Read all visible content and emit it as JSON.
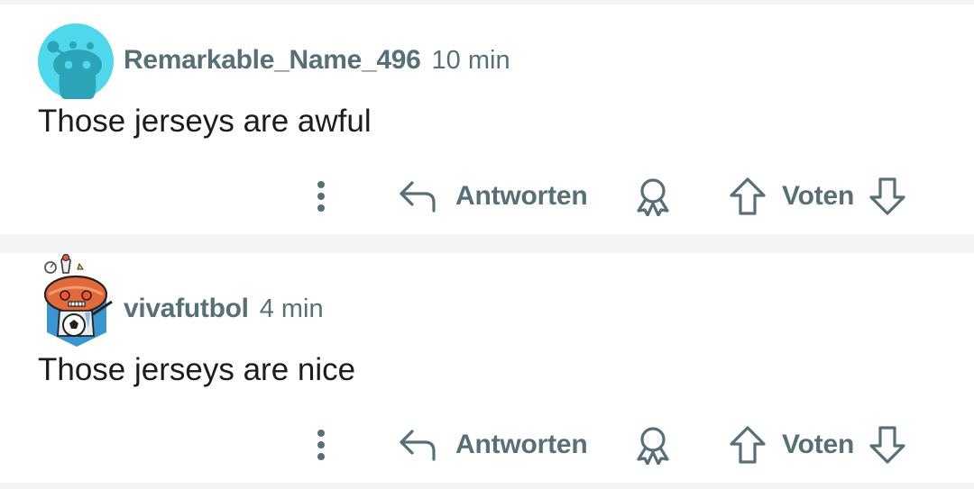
{
  "comments": [
    {
      "username": "Remarkable_Name_496",
      "time": "10 min",
      "text": "Those jerseys are awful",
      "avatar_icon": "snoo-avatar-icon",
      "avatar_bg": "#4FD8EB"
    },
    {
      "username": "vivafutbol",
      "time": "4 min",
      "text": "Those jerseys are nice",
      "avatar_icon": "snoo-football-avatar-icon",
      "avatar_bg": "#FFFFFF"
    }
  ],
  "actions": {
    "more_icon": "more-vertical-icon",
    "reply_icon": "reply-arrow-icon",
    "reply_label": "Antworten",
    "award_icon": "award-icon",
    "upvote_icon": "upvote-arrow-icon",
    "vote_label": "Voten",
    "downvote_icon": "downvote-arrow-icon"
  },
  "colors": {
    "background": "#F2F4F5",
    "card": "#FFFFFF",
    "muted_text": "#576F76",
    "body_text": "#1C1C1C"
  }
}
